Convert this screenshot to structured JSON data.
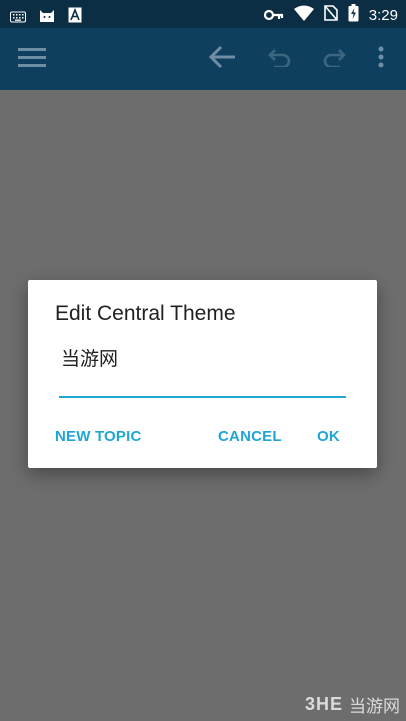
{
  "status_bar": {
    "time": "3:29",
    "icons_left": [
      "keyboard-icon",
      "cat-icon",
      "font-a-icon"
    ],
    "icons_right": [
      "key-icon",
      "wifi-icon",
      "no-sim-icon",
      "battery-charging-icon"
    ]
  },
  "toolbar": {
    "icons": [
      "menu-icon",
      "back-arrow-icon",
      "undo-icon",
      "redo-icon",
      "more-vert-icon"
    ]
  },
  "dialog": {
    "title": "Edit Central Theme",
    "input_value": "当游网",
    "buttons": {
      "new_topic": "NEW TOPIC",
      "cancel": "CANCEL",
      "ok": "OK"
    }
  },
  "watermark": {
    "logo": "3HE",
    "text": "当游网"
  },
  "colors": {
    "status_bar": "#0b2e44",
    "toolbar": "#0f3f5f",
    "accent": "#1fa7d4",
    "scrim": "#6d6d6d"
  }
}
